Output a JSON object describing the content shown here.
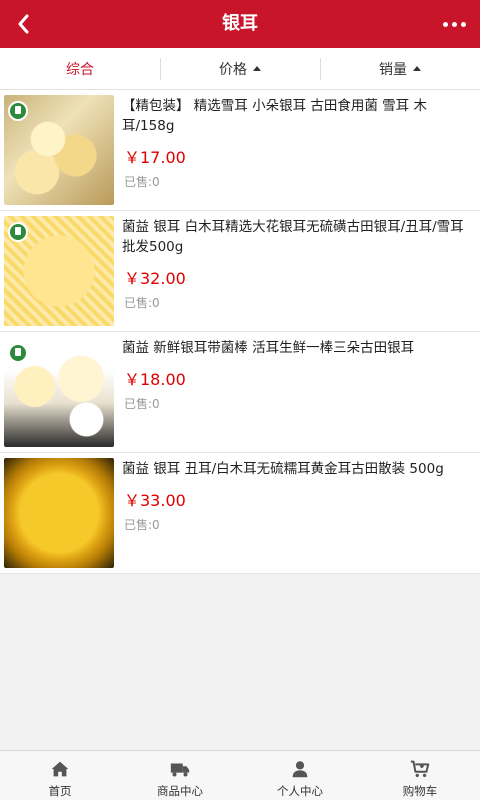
{
  "header": {
    "title": "银耳",
    "back_icon": "chevron-left-icon",
    "more_icon": "more-dots-icon",
    "color": "#c8152a"
  },
  "sort": {
    "options": [
      {
        "label": "综合",
        "active": true
      },
      {
        "label": "价格",
        "caret": "up"
      },
      {
        "label": "销量",
        "caret": "up"
      }
    ]
  },
  "products": [
    {
      "name": "【精包装】 精选雪耳 小朵银耳 古田食用菌 雪耳 木耳/158g",
      "price": "￥17.00",
      "sold": "已售:0"
    },
    {
      "name": "菌益 银耳 白木耳精选大花银耳无硫磺古田银耳/丑耳/雪耳批发500g",
      "price": "￥32.00",
      "sold": "已售:0"
    },
    {
      "name": "菌益 新鲜银耳带菌棒 活耳生鲜一棒三朵古田银耳",
      "price": "￥18.00",
      "sold": "已售:0"
    },
    {
      "name": "菌益 银耳 丑耳/白木耳无硫糯耳黄金耳古田散装 500g",
      "price": "￥33.00",
      "sold": "已售:0"
    }
  ],
  "tabbar": {
    "items": [
      {
        "label": "首页",
        "icon": "home-icon"
      },
      {
        "label": "商品中心",
        "icon": "truck-icon"
      },
      {
        "label": "个人中心",
        "icon": "user-icon"
      },
      {
        "label": "购物车",
        "icon": "cart-icon"
      }
    ]
  }
}
